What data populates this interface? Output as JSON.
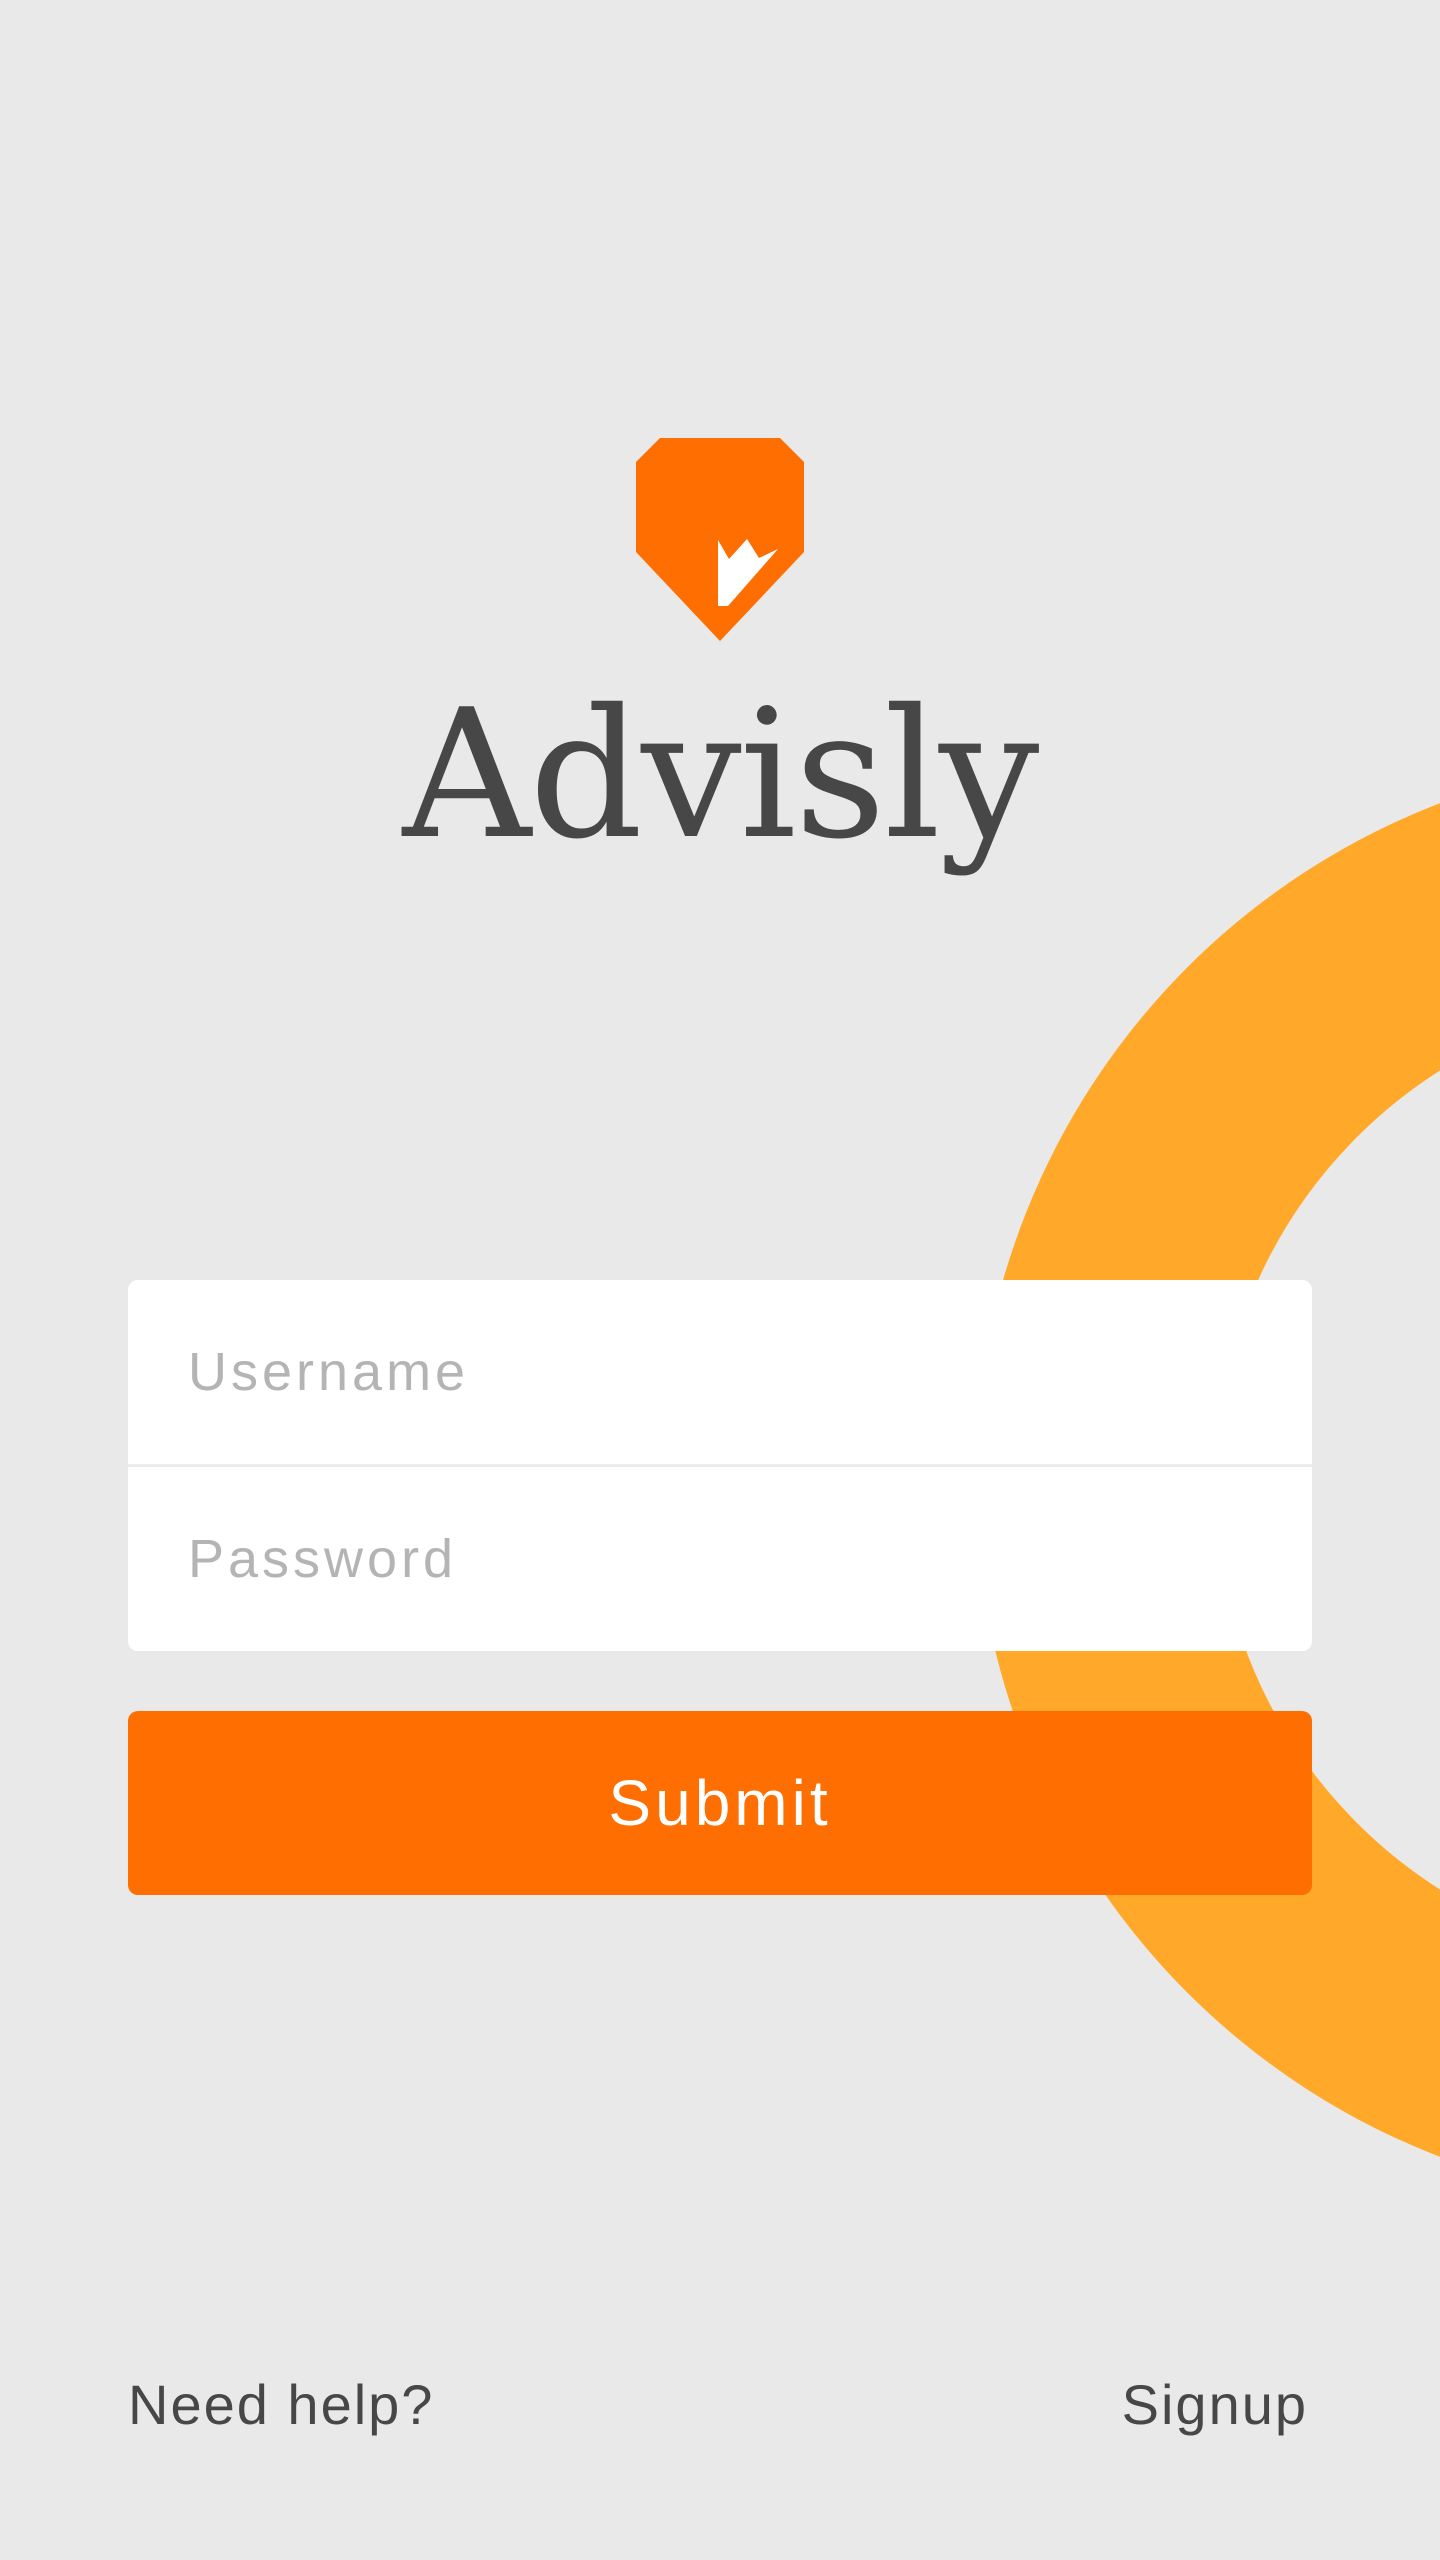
{
  "brand": {
    "name": "Advisly",
    "logo_icon": "shield-crown-icon",
    "logo_color": "#ff6e00",
    "wordmark_color": "#474747"
  },
  "background": {
    "color": "#e9e9e9",
    "ring_color": "#ffa82a"
  },
  "login_form": {
    "username": {
      "placeholder": "Username",
      "value": ""
    },
    "password": {
      "placeholder": "Password",
      "value": ""
    },
    "submit_label": "Submit",
    "submit_color": "#ff6e00"
  },
  "footer": {
    "help_label": "Need help?",
    "signup_label": "Signup"
  }
}
